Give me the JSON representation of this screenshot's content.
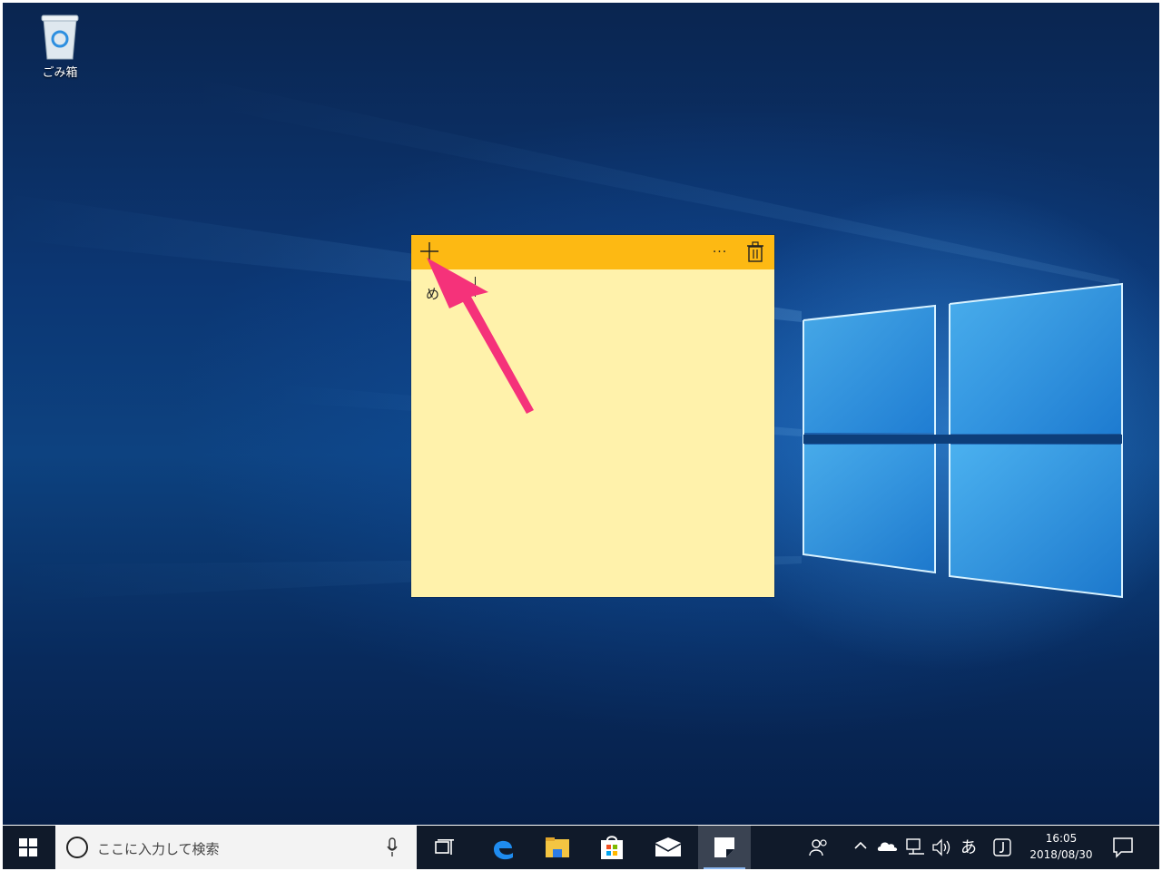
{
  "desktop": {
    "recycle_bin_label": "ごみ箱"
  },
  "sticky_note": {
    "add_icon": "plus-icon",
    "menu_label": "···",
    "delete_icon": "trash-icon",
    "text": "め",
    "bar_color": "#fdb913",
    "body_color": "#fff2ab"
  },
  "annotation": {
    "arrow_color": "#f5327a"
  },
  "taskbar": {
    "start_icon": "windows-logo-icon",
    "search_placeholder": "ここに入力して検索",
    "pinned": [
      "task-view-icon",
      "edge-icon",
      "file-explorer-icon",
      "store-icon",
      "mail-icon",
      "sticky-notes-icon"
    ],
    "tray": {
      "ime_label": "あ",
      "time": "16:05",
      "date": "2018/08/30"
    }
  }
}
